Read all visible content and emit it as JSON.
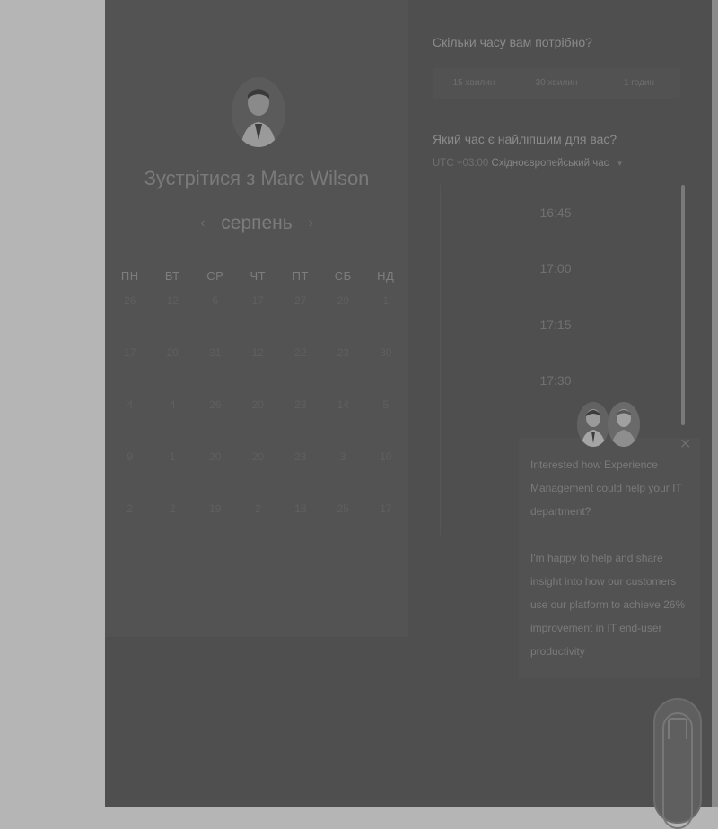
{
  "calendar": {
    "title_prefix": "Зустрітися з",
    "host_name": "Marc Wilson",
    "month": "серпень",
    "prev_icon": "chevron-left-icon",
    "next_icon": "chevron-right-icon",
    "weekdays": [
      "ПН",
      "ВТ",
      "СР",
      "ЧТ",
      "ПТ",
      "СБ",
      "НД"
    ],
    "rows": [
      [
        "26",
        "12",
        "6",
        "17",
        "27",
        "29",
        "1"
      ],
      [
        "17",
        "20",
        "31",
        "12",
        "22",
        "23",
        "30"
      ],
      [
        "4",
        "4",
        "26",
        "20",
        "23",
        "14",
        "5"
      ],
      [
        "9",
        "1",
        "20",
        "20",
        "23",
        "3",
        "10"
      ],
      [
        "2",
        "2",
        "19",
        "2",
        "18",
        "25",
        "17"
      ]
    ]
  },
  "booking": {
    "duration_question": "Скільки часу вам потрібно?",
    "durations": [
      "15 хвилин",
      "30 хвилин",
      "1 годин"
    ],
    "time_question": "Який час є найліпшим для вас?",
    "tz_offset": "UTC +03:00",
    "tz_name": "Східноєвропейський час",
    "tz_caret_icon": "caret-down-icon",
    "slots": [
      "16:45",
      "17:00",
      "17:15",
      "17:30"
    ]
  },
  "chat": {
    "close_icon": "close-icon",
    "message_1": "Interested how Experience Management could help your IT department?",
    "message_2": "I'm happy to help and share insight into how our customers use our platform to achieve 26% improvement in IT end-user productivity"
  },
  "colors": {
    "overlay": "#4f4f4f",
    "backdrop": "#b5b5b5"
  }
}
